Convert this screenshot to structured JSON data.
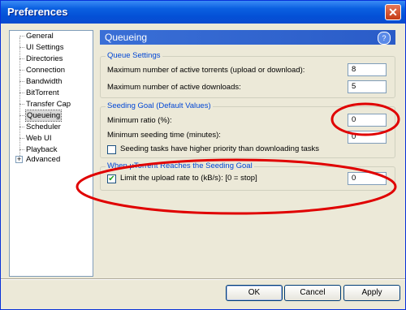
{
  "window": {
    "title": "Preferences"
  },
  "sidebar": {
    "items": [
      {
        "label": "General"
      },
      {
        "label": "UI Settings"
      },
      {
        "label": "Directories"
      },
      {
        "label": "Connection"
      },
      {
        "label": "Bandwidth"
      },
      {
        "label": "BitTorrent"
      },
      {
        "label": "Transfer Cap"
      },
      {
        "label": "Queueing",
        "selected": true
      },
      {
        "label": "Scheduler"
      },
      {
        "label": "Web UI"
      },
      {
        "label": "Playback"
      },
      {
        "label": "Advanced",
        "expandable": true
      }
    ],
    "expander_symbol": "+"
  },
  "panel": {
    "title": "Queueing",
    "help_symbol": "?",
    "queue": {
      "legend": "Queue Settings",
      "max_active_torrents_label": "Maximum number of active torrents (upload or download):",
      "max_active_torrents_value": "8",
      "max_active_downloads_label": "Maximum number of active downloads:",
      "max_active_downloads_value": "5"
    },
    "seeding": {
      "legend": "Seeding Goal (Default Values)",
      "min_ratio_label": "Minimum ratio (%):",
      "min_ratio_value": "0",
      "min_seed_time_label": "Minimum seeding time (minutes):",
      "min_seed_time_value": "0",
      "priority_label": "Seeding tasks have higher priority than downloading tasks",
      "priority_checked": false
    },
    "goal": {
      "legend": "When µTorrent Reaches the Seeding Goal",
      "limit_label": "Limit the upload rate to (kB/s): [0 = stop]",
      "limit_checked": true,
      "limit_value": "0"
    }
  },
  "buttons": {
    "ok": "OK",
    "cancel": "Cancel",
    "apply": "Apply"
  },
  "colors": {
    "titlebar": "#0a5fe0",
    "header": "#2a5cc8",
    "annotation": "#e00000"
  }
}
